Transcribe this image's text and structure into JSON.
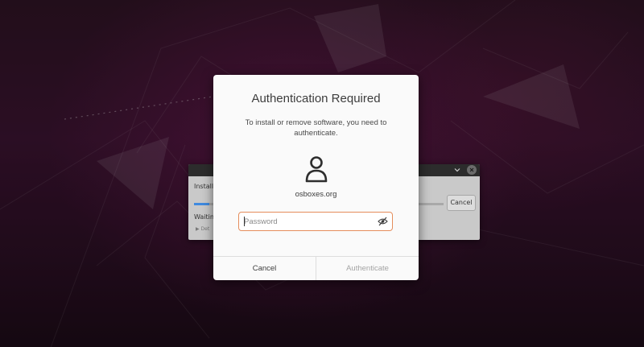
{
  "dialog": {
    "title": "Authentication Required",
    "message": "To install or remove software, you need to authenticate.",
    "username": "osboxes.org",
    "password_placeholder": "Password",
    "password_value": "",
    "cancel_label": "Cancel",
    "authenticate_label": "Authenticate",
    "icons": {
      "user": "user-avatar-icon",
      "reveal": "eye-slash-icon"
    },
    "colors": {
      "focus_border": "#e58d5c",
      "background": "#fafafa"
    }
  },
  "background_window": {
    "label_top": "Install",
    "status": "Waiting",
    "detail_label": "Det",
    "cancel_label": "Cancel",
    "progress": 0.06,
    "icons": {
      "minimize": "chevron-down-icon",
      "close": "close-icon"
    }
  },
  "colors": {
    "wallpaper": "#3a1330",
    "accent": "#3f8ae0"
  }
}
